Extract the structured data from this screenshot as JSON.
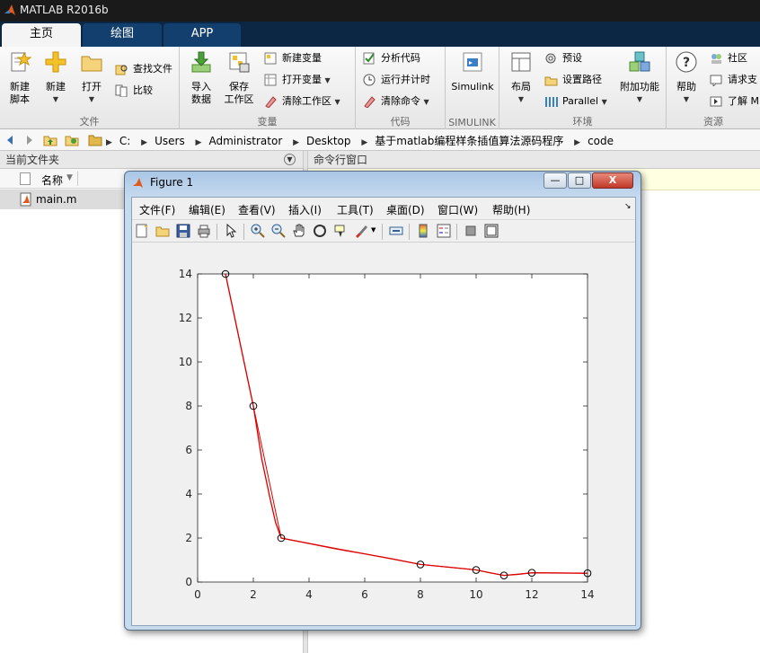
{
  "window": {
    "title": "MATLAB R2016b"
  },
  "tabs": [
    {
      "label": "主页",
      "active": true
    },
    {
      "label": "绘图",
      "active": false
    },
    {
      "label": "APP",
      "active": false
    }
  ],
  "ribbon": {
    "file": {
      "caption": "文件",
      "new_script": "新建\n脚本",
      "new": "新建",
      "open": "打开",
      "find_files": "查找文件",
      "compare": "比较"
    },
    "variable": {
      "caption": "变量",
      "import_data": "导入\n数据",
      "save_workspace": "保存\n工作区",
      "new_variable": "新建变量",
      "open_variable": "打开变量",
      "clear_workspace": "清除工作区"
    },
    "code": {
      "caption": "代码",
      "analyze_code": "分析代码",
      "run_and_time": "运行并计时",
      "clear_commands": "清除命令"
    },
    "simulink": {
      "caption": "SIMULINK",
      "label": "Simulink"
    },
    "environment": {
      "caption": "环境",
      "layout": "布局",
      "preferences": "预设",
      "set_path": "设置路径",
      "parallel": "Parallel",
      "addons": "附加功能"
    },
    "resources": {
      "caption": "资源",
      "help": "帮助",
      "community": "社区",
      "request_support": "请求支",
      "learn": "了解 M"
    }
  },
  "address": {
    "crumbs": [
      "C:",
      "Users",
      "Administrator",
      "Desktop",
      "基于matlab编程样条插值算法源码程序",
      "code"
    ]
  },
  "current_folder": {
    "title": "当前文件夹",
    "column_name": "名称",
    "files": [
      "main.m"
    ]
  },
  "command_window": {
    "title": "命令行窗口"
  },
  "figure": {
    "title": "Figure 1",
    "menu": [
      "文件(F)",
      "编辑(E)",
      "查看(V)",
      "插入(I)",
      "工具(T)",
      "桌面(D)",
      "窗口(W)",
      "帮助(H)"
    ],
    "buttons": {
      "minimize": "—",
      "maximize": "□",
      "close": "X"
    }
  },
  "chart_data": {
    "type": "line",
    "title": "",
    "xlabel": "",
    "ylabel": "",
    "xlim": [
      0,
      14
    ],
    "ylim": [
      0,
      14
    ],
    "xticks": [
      0,
      2,
      4,
      6,
      8,
      10,
      12,
      14
    ],
    "yticks": [
      0,
      2,
      4,
      6,
      8,
      10,
      12,
      14
    ],
    "grid": false,
    "points": {
      "name": "",
      "marker": "circle",
      "color": "#000000",
      "x": [
        1,
        2,
        3,
        8,
        10,
        11,
        12,
        14
      ],
      "y": [
        14,
        8,
        2,
        0.8,
        0.55,
        0.3,
        0.42,
        0.4
      ]
    },
    "curve": {
      "name": "",
      "color": "#dd0000",
      "x": [
        1,
        1.5,
        2,
        2.3,
        2.6,
        2.8,
        3,
        4,
        5,
        6,
        7,
        8,
        9,
        10,
        10.5,
        11,
        11.5,
        12,
        13,
        14
      ],
      "y": [
        14,
        11,
        8,
        5.6,
        3.8,
        2.7,
        2,
        1.75,
        1.5,
        1.28,
        1.05,
        0.8,
        0.68,
        0.55,
        0.42,
        0.3,
        0.35,
        0.42,
        0.41,
        0.4
      ]
    }
  }
}
